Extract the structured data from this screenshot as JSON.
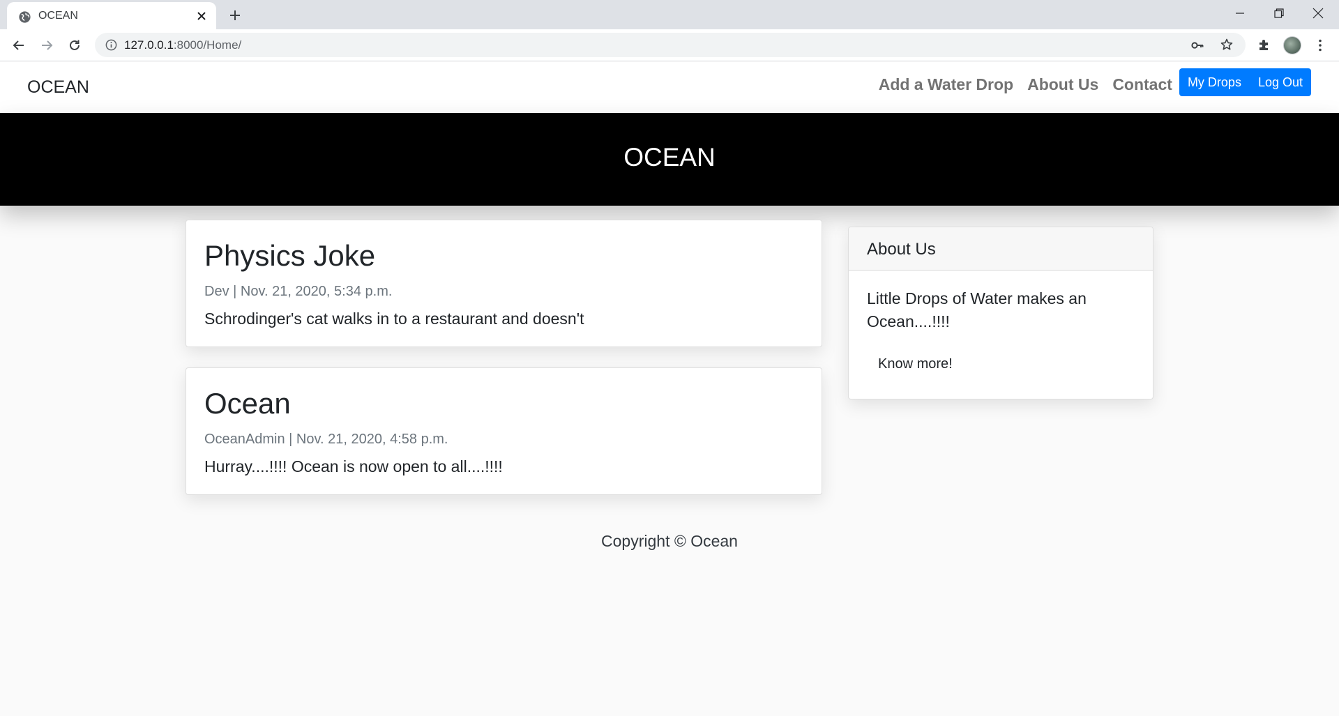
{
  "browser": {
    "tab_title": "OCEAN",
    "url_host": "127.0.0.1",
    "url_rest": ":8000/Home/"
  },
  "navbar": {
    "brand": "OCEAN",
    "links": [
      "Add a Water Drop",
      "About Us",
      "Contact"
    ],
    "buttons": [
      "My Drops",
      "Log Out"
    ]
  },
  "hero": {
    "title": "OCEAN"
  },
  "posts": [
    {
      "title": "Physics Joke",
      "meta": "Dev | Nov. 21, 2020, 5:34 p.m.",
      "body": "Schrodinger's cat walks in to a restaurant and doesn't"
    },
    {
      "title": "Ocean",
      "meta": "OceanAdmin | Nov. 21, 2020, 4:58 p.m.",
      "body": "Hurray....!!!! Ocean is now open to all....!!!!"
    }
  ],
  "sidebar": {
    "title": "About Us",
    "text": "Little Drops of Water makes an Ocean....!!!!",
    "link": "Know more!"
  },
  "footer": {
    "text": "Copyright © Ocean"
  },
  "colors": {
    "accent": "#007bff",
    "hero_bg": "#000000"
  }
}
